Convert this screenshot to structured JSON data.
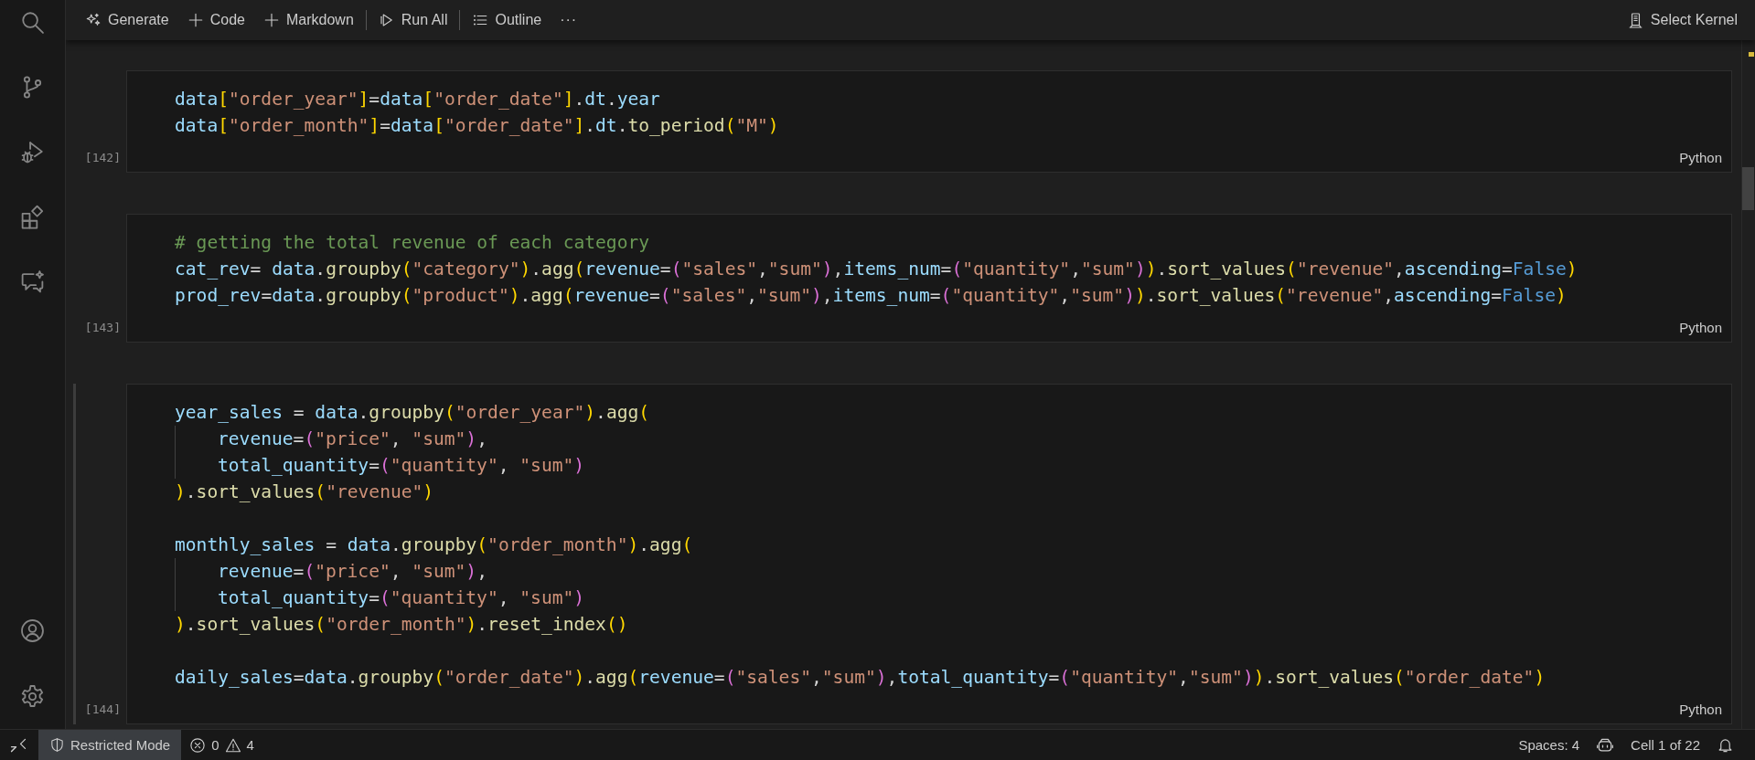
{
  "toolbar": {
    "items": [
      {
        "kind": "button",
        "label": "Generate"
      },
      {
        "kind": "button",
        "label": "Code"
      },
      {
        "kind": "button",
        "label": "Markdown"
      },
      {
        "kind": "separator"
      },
      {
        "kind": "button",
        "label": "Run All"
      },
      {
        "kind": "separator"
      },
      {
        "kind": "button",
        "label": "Outline"
      },
      {
        "kind": "more",
        "label": "···"
      }
    ],
    "kernel": {
      "label": "Select Kernel"
    }
  },
  "cells": [
    {
      "execution_count": "[142]",
      "language": "Python",
      "selected": false,
      "lines": [
        {
          "kind": "code",
          "tokens": [
            {
              "kind": "var",
              "text": "data"
            },
            {
              "kind": "b1",
              "text": "["
            },
            {
              "kind": "str",
              "text": "\"order_year\""
            },
            {
              "kind": "b1",
              "text": "]"
            },
            {
              "kind": "op",
              "text": "="
            },
            {
              "kind": "var",
              "text": "data"
            },
            {
              "kind": "b1",
              "text": "["
            },
            {
              "kind": "str",
              "text": "\"order_date\""
            },
            {
              "kind": "b1",
              "text": "]"
            },
            {
              "kind": "op",
              "text": "."
            },
            {
              "kind": "var",
              "text": "dt"
            },
            {
              "kind": "op",
              "text": "."
            },
            {
              "kind": "var",
              "text": "year"
            }
          ]
        },
        {
          "kind": "code",
          "tokens": [
            {
              "kind": "var",
              "text": "data"
            },
            {
              "kind": "b1",
              "text": "["
            },
            {
              "kind": "str",
              "text": "\"order_month\""
            },
            {
              "kind": "b1",
              "text": "]"
            },
            {
              "kind": "op",
              "text": "="
            },
            {
              "kind": "var",
              "text": "data"
            },
            {
              "kind": "b1",
              "text": "["
            },
            {
              "kind": "str",
              "text": "\"order_date\""
            },
            {
              "kind": "b1",
              "text": "]"
            },
            {
              "kind": "op",
              "text": "."
            },
            {
              "kind": "var",
              "text": "dt"
            },
            {
              "kind": "op",
              "text": "."
            },
            {
              "kind": "fn",
              "text": "to_period"
            },
            {
              "kind": "b1",
              "text": "("
            },
            {
              "kind": "str",
              "text": "\"M\""
            },
            {
              "kind": "b1",
              "text": ")"
            }
          ]
        }
      ]
    },
    {
      "execution_count": "[143]",
      "language": "Python",
      "selected": false,
      "lines": [
        {
          "kind": "code",
          "tokens": [
            {
              "kind": "comment",
              "text": "# getting the total revenue of each category"
            }
          ]
        },
        {
          "kind": "code",
          "tokens": [
            {
              "kind": "var",
              "text": "cat_rev"
            },
            {
              "kind": "op",
              "text": "= "
            },
            {
              "kind": "var",
              "text": "data"
            },
            {
              "kind": "op",
              "text": "."
            },
            {
              "kind": "fn",
              "text": "groupby"
            },
            {
              "kind": "b1",
              "text": "("
            },
            {
              "kind": "str",
              "text": "\"category\""
            },
            {
              "kind": "b1",
              "text": ")"
            },
            {
              "kind": "op",
              "text": "."
            },
            {
              "kind": "fn",
              "text": "agg"
            },
            {
              "kind": "b1",
              "text": "("
            },
            {
              "kind": "var",
              "text": "revenue"
            },
            {
              "kind": "op",
              "text": "="
            },
            {
              "kind": "b2",
              "text": "("
            },
            {
              "kind": "str",
              "text": "\"sales\""
            },
            {
              "kind": "op",
              "text": ","
            },
            {
              "kind": "str",
              "text": "\"sum\""
            },
            {
              "kind": "b2",
              "text": ")"
            },
            {
              "kind": "op",
              "text": ","
            },
            {
              "kind": "var",
              "text": "items_num"
            },
            {
              "kind": "op",
              "text": "="
            },
            {
              "kind": "b2",
              "text": "("
            },
            {
              "kind": "str",
              "text": "\"quantity\""
            },
            {
              "kind": "op",
              "text": ","
            },
            {
              "kind": "str",
              "text": "\"sum\""
            },
            {
              "kind": "b2",
              "text": ")"
            },
            {
              "kind": "b1",
              "text": ")"
            },
            {
              "kind": "op",
              "text": "."
            },
            {
              "kind": "fn",
              "text": "sort_values"
            },
            {
              "kind": "b1",
              "text": "("
            },
            {
              "kind": "str",
              "text": "\"revenue\""
            },
            {
              "kind": "op",
              "text": ","
            },
            {
              "kind": "var",
              "text": "ascending"
            },
            {
              "kind": "op",
              "text": "="
            },
            {
              "kind": "const",
              "text": "False"
            },
            {
              "kind": "b1",
              "text": ")"
            }
          ]
        },
        {
          "kind": "code",
          "tokens": [
            {
              "kind": "var",
              "text": "prod_rev"
            },
            {
              "kind": "op",
              "text": "="
            },
            {
              "kind": "var",
              "text": "data"
            },
            {
              "kind": "op",
              "text": "."
            },
            {
              "kind": "fn",
              "text": "groupby"
            },
            {
              "kind": "b1",
              "text": "("
            },
            {
              "kind": "str",
              "text": "\"product\""
            },
            {
              "kind": "b1",
              "text": ")"
            },
            {
              "kind": "op",
              "text": "."
            },
            {
              "kind": "fn",
              "text": "agg"
            },
            {
              "kind": "b1",
              "text": "("
            },
            {
              "kind": "var",
              "text": "revenue"
            },
            {
              "kind": "op",
              "text": "="
            },
            {
              "kind": "b2",
              "text": "("
            },
            {
              "kind": "str",
              "text": "\"sales\""
            },
            {
              "kind": "op",
              "text": ","
            },
            {
              "kind": "str",
              "text": "\"sum\""
            },
            {
              "kind": "b2",
              "text": ")"
            },
            {
              "kind": "op",
              "text": ","
            },
            {
              "kind": "var",
              "text": "items_num"
            },
            {
              "kind": "op",
              "text": "="
            },
            {
              "kind": "b2",
              "text": "("
            },
            {
              "kind": "str",
              "text": "\"quantity\""
            },
            {
              "kind": "op",
              "text": ","
            },
            {
              "kind": "str",
              "text": "\"sum\""
            },
            {
              "kind": "b2",
              "text": ")"
            },
            {
              "kind": "b1",
              "text": ")"
            },
            {
              "kind": "op",
              "text": "."
            },
            {
              "kind": "fn",
              "text": "sort_values"
            },
            {
              "kind": "b1",
              "text": "("
            },
            {
              "kind": "str",
              "text": "\"revenue\""
            },
            {
              "kind": "op",
              "text": ","
            },
            {
              "kind": "var",
              "text": "ascending"
            },
            {
              "kind": "op",
              "text": "="
            },
            {
              "kind": "const",
              "text": "False"
            },
            {
              "kind": "b1",
              "text": ")"
            }
          ]
        }
      ]
    },
    {
      "execution_count": "[144]",
      "language": "Python",
      "selected": true,
      "lines": [
        {
          "kind": "code",
          "tokens": [
            {
              "kind": "var",
              "text": "year_sales"
            },
            {
              "kind": "op",
              "text": " = "
            },
            {
              "kind": "var",
              "text": "data"
            },
            {
              "kind": "op",
              "text": "."
            },
            {
              "kind": "fn",
              "text": "groupby"
            },
            {
              "kind": "b1",
              "text": "("
            },
            {
              "kind": "str",
              "text": "\"order_year\""
            },
            {
              "kind": "b1",
              "text": ")"
            },
            {
              "kind": "op",
              "text": "."
            },
            {
              "kind": "fn",
              "text": "agg"
            },
            {
              "kind": "b1",
              "text": "("
            }
          ]
        },
        {
          "kind": "indented",
          "tokens": [
            {
              "kind": "var",
              "text": "revenue"
            },
            {
              "kind": "op",
              "text": "="
            },
            {
              "kind": "b2",
              "text": "("
            },
            {
              "kind": "str",
              "text": "\"price\""
            },
            {
              "kind": "op",
              "text": ", "
            },
            {
              "kind": "str",
              "text": "\"sum\""
            },
            {
              "kind": "b2",
              "text": ")"
            },
            {
              "kind": "op",
              "text": ","
            }
          ]
        },
        {
          "kind": "indented",
          "tokens": [
            {
              "kind": "var",
              "text": "total_quantity"
            },
            {
              "kind": "op",
              "text": "="
            },
            {
              "kind": "b2",
              "text": "("
            },
            {
              "kind": "str",
              "text": "\"quantity\""
            },
            {
              "kind": "op",
              "text": ", "
            },
            {
              "kind": "str",
              "text": "\"sum\""
            },
            {
              "kind": "b2",
              "text": ")"
            }
          ]
        },
        {
          "kind": "code",
          "tokens": [
            {
              "kind": "b1",
              "text": ")"
            },
            {
              "kind": "op",
              "text": "."
            },
            {
              "kind": "fn",
              "text": "sort_values"
            },
            {
              "kind": "b1",
              "text": "("
            },
            {
              "kind": "str",
              "text": "\"revenue\""
            },
            {
              "kind": "b1",
              "text": ")"
            }
          ]
        },
        {
          "kind": "blank"
        },
        {
          "kind": "code",
          "tokens": [
            {
              "kind": "var",
              "text": "monthly_sales"
            },
            {
              "kind": "op",
              "text": " = "
            },
            {
              "kind": "var",
              "text": "data"
            },
            {
              "kind": "op",
              "text": "."
            },
            {
              "kind": "fn",
              "text": "groupby"
            },
            {
              "kind": "b1",
              "text": "("
            },
            {
              "kind": "str",
              "text": "\"order_month\""
            },
            {
              "kind": "b1",
              "text": ")"
            },
            {
              "kind": "op",
              "text": "."
            },
            {
              "kind": "fn",
              "text": "agg"
            },
            {
              "kind": "b1",
              "text": "("
            }
          ]
        },
        {
          "kind": "indented",
          "tokens": [
            {
              "kind": "var",
              "text": "revenue"
            },
            {
              "kind": "op",
              "text": "="
            },
            {
              "kind": "b2",
              "text": "("
            },
            {
              "kind": "str",
              "text": "\"price\""
            },
            {
              "kind": "op",
              "text": ", "
            },
            {
              "kind": "str",
              "text": "\"sum\""
            },
            {
              "kind": "b2",
              "text": ")"
            },
            {
              "kind": "op",
              "text": ","
            }
          ]
        },
        {
          "kind": "indented",
          "tokens": [
            {
              "kind": "var",
              "text": "total_quantity"
            },
            {
              "kind": "op",
              "text": "="
            },
            {
              "kind": "b2",
              "text": "("
            },
            {
              "kind": "str",
              "text": "\"quantity\""
            },
            {
              "kind": "op",
              "text": ", "
            },
            {
              "kind": "str",
              "text": "\"sum\""
            },
            {
              "kind": "b2",
              "text": ")"
            }
          ]
        },
        {
          "kind": "code",
          "tokens": [
            {
              "kind": "b1",
              "text": ")"
            },
            {
              "kind": "op",
              "text": "."
            },
            {
              "kind": "fn",
              "text": "sort_values"
            },
            {
              "kind": "b1",
              "text": "("
            },
            {
              "kind": "str",
              "text": "\"order_month\""
            },
            {
              "kind": "b1",
              "text": ")"
            },
            {
              "kind": "op",
              "text": "."
            },
            {
              "kind": "fn",
              "text": "reset_index"
            },
            {
              "kind": "b1",
              "text": "()"
            }
          ]
        },
        {
          "kind": "blank"
        },
        {
          "kind": "code",
          "tokens": [
            {
              "kind": "var",
              "text": "daily_sales"
            },
            {
              "kind": "op",
              "text": "="
            },
            {
              "kind": "var",
              "text": "data"
            },
            {
              "kind": "op",
              "text": "."
            },
            {
              "kind": "fn",
              "text": "groupby"
            },
            {
              "kind": "b1",
              "text": "("
            },
            {
              "kind": "str",
              "text": "\"order_date\""
            },
            {
              "kind": "b1",
              "text": ")"
            },
            {
              "kind": "op",
              "text": "."
            },
            {
              "kind": "fn",
              "text": "agg"
            },
            {
              "kind": "b1",
              "text": "("
            },
            {
              "kind": "var",
              "text": "revenue"
            },
            {
              "kind": "op",
              "text": "="
            },
            {
              "kind": "b2",
              "text": "("
            },
            {
              "kind": "str",
              "text": "\"sales\""
            },
            {
              "kind": "op",
              "text": ","
            },
            {
              "kind": "str",
              "text": "\"sum\""
            },
            {
              "kind": "b2",
              "text": ")"
            },
            {
              "kind": "op",
              "text": ","
            },
            {
              "kind": "var",
              "text": "total_quantity"
            },
            {
              "kind": "op",
              "text": "="
            },
            {
              "kind": "b2",
              "text": "("
            },
            {
              "kind": "str",
              "text": "\"quantity\""
            },
            {
              "kind": "op",
              "text": ","
            },
            {
              "kind": "str",
              "text": "\"sum\""
            },
            {
              "kind": "b2",
              "text": ")"
            },
            {
              "kind": "b1",
              "text": ")"
            },
            {
              "kind": "op",
              "text": "."
            },
            {
              "kind": "fn",
              "text": "sort_values"
            },
            {
              "kind": "b1",
              "text": "("
            },
            {
              "kind": "str",
              "text": "\"order_date\""
            },
            {
              "kind": "b1",
              "text": ")"
            }
          ]
        }
      ]
    }
  ],
  "status_bar": {
    "mode": "Restricted Mode",
    "errors": "0",
    "warnings": "4",
    "indentation": "Spaces: 4",
    "cell_position": "Cell 1 of 22"
  }
}
